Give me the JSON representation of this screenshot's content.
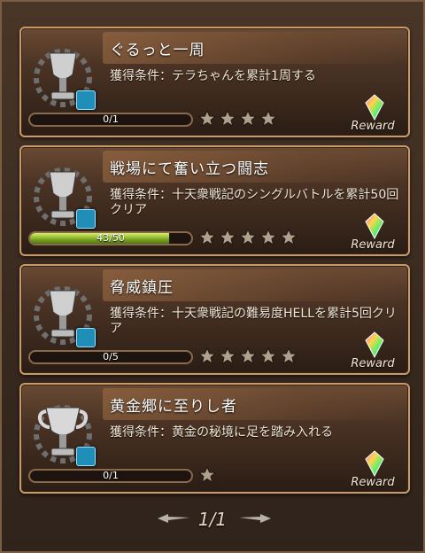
{
  "cards": [
    {
      "title": "ぐるっと一周",
      "condition": "獲得条件：テラちゃんを累計1周する",
      "progress_text": "0/1",
      "progress_fraction": 0,
      "stars": 4,
      "trophy": "silver-cup-icon",
      "reward_label": "Reward"
    },
    {
      "title": "戦場にて奮い立つ闘志",
      "condition": "獲得条件：十天衆戦記のシングルバトルを累計50回クリア",
      "progress_text": "43/50",
      "progress_fraction": 0.86,
      "stars": 5,
      "trophy": "silver-cup-icon",
      "reward_label": "Reward"
    },
    {
      "title": "脅威鎮圧",
      "condition": "獲得条件：十天衆戦記の難易度HELLを累計5回クリア",
      "progress_text": "0/5",
      "progress_fraction": 0,
      "stars": 5,
      "trophy": "silver-cup-icon",
      "reward_label": "Reward"
    },
    {
      "title": "黄金郷に至りし者",
      "condition": "獲得条件：黄金の秘境に足を踏み入れる",
      "progress_text": "0/1",
      "progress_fraction": 0,
      "stars": 1,
      "trophy": "silver-trophy-icon",
      "reward_label": "Reward"
    }
  ],
  "pager": {
    "current": "1/1"
  },
  "colors": {
    "card_border": "#c79a6a",
    "progress_fill": "#8fbf2a",
    "lock": "#1f8fb8"
  }
}
